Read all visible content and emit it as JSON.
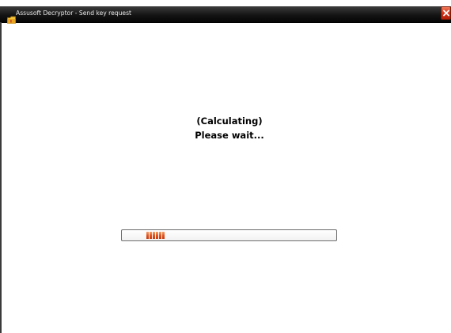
{
  "window": {
    "title": "Assusoft Decryptor - Send key request"
  },
  "status": {
    "line1": "(Calculating)",
    "line2": "Please wait..."
  },
  "progress": {
    "indeterminate": true,
    "block_count": 6,
    "block_color": "#e0501c"
  },
  "icons": {
    "app": "folder-icon",
    "close": "close-icon"
  },
  "colors": {
    "titlebar": "#141414",
    "close_button": "#d4341a",
    "background": "#ffffff"
  }
}
